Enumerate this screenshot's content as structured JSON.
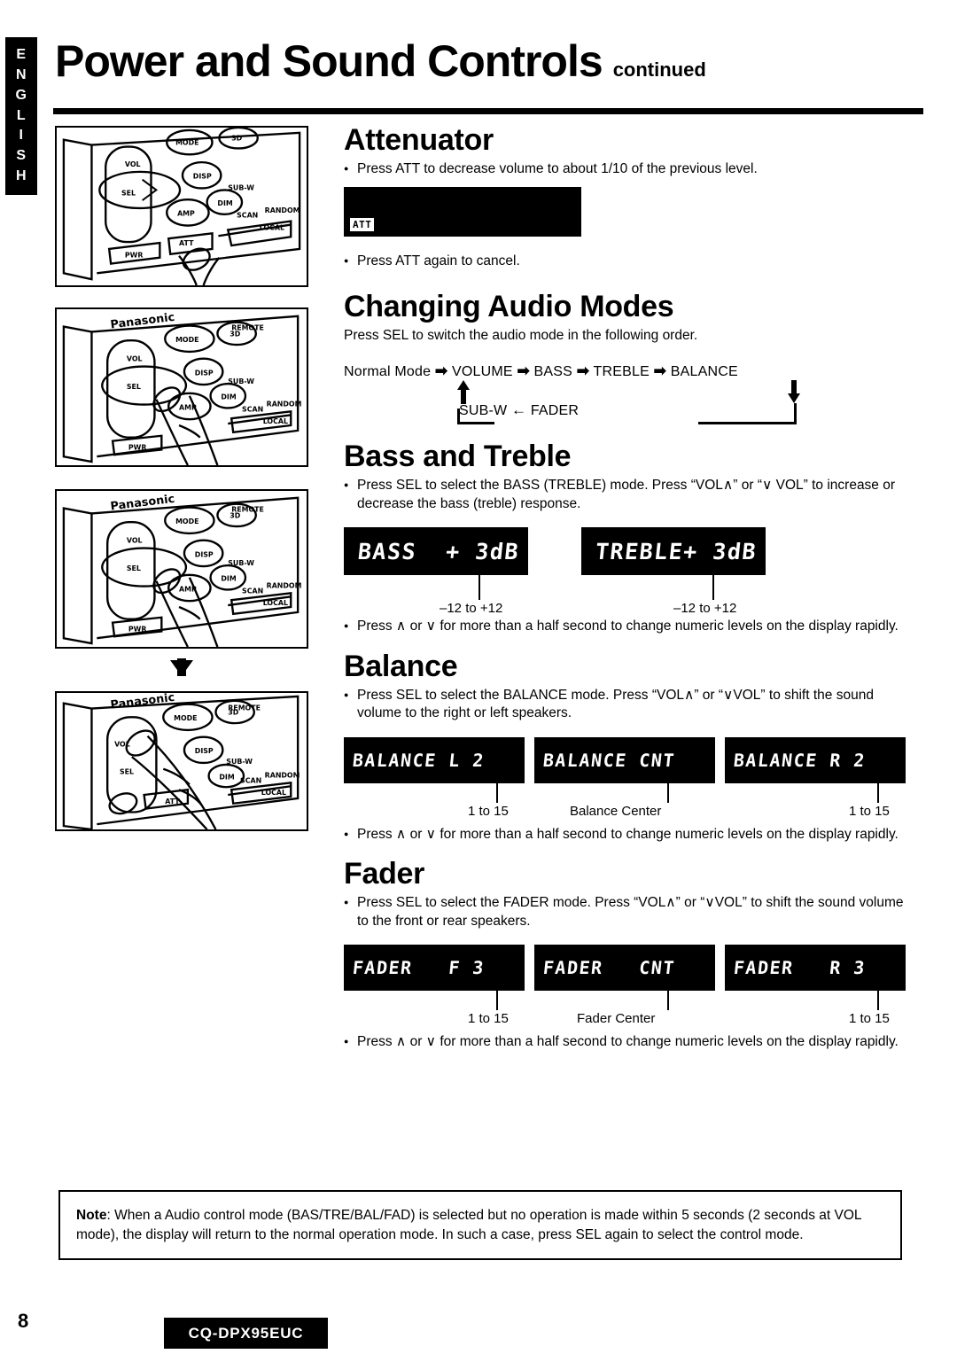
{
  "language_tab": "ENGLISH",
  "header": {
    "title": "Power and Sound Controls",
    "continued": "continued"
  },
  "illustrations": [
    {
      "name": "att-button-press",
      "caption": ""
    },
    {
      "name": "sel-button-press",
      "caption": ""
    },
    {
      "name": "sel-button-press-2",
      "caption": ""
    },
    {
      "name": "vol-up-button-press",
      "caption": ""
    }
  ],
  "sections": {
    "attenuator": {
      "title": "Attenuator",
      "bullet_1": "Press ATT to decrease volume to about 1/10 of the previous level.",
      "display": {
        "badge": "ATT"
      },
      "bullet_2": "Press ATT again to cancel."
    },
    "changing_audio_modes": {
      "title": "Changing Audio Modes",
      "intro": "Press SEL to switch the audio mode in the following order.",
      "flow_row_1": "Normal Mode",
      "flow_nodes_top": [
        "VOLUME",
        "BASS",
        "TREBLE",
        "BALANCE"
      ],
      "flow_nodes_bottom": [
        "SUB-W",
        "FADER"
      ],
      "arrow_right": "➡",
      "arrow_left": "←"
    },
    "bass_and_treble": {
      "title": "Bass and Treble",
      "bullet_1": "Press SEL to select the BASS (TREBLE) mode. Press “VOL∧” or “∨ VOL” to increase or decrease the bass (treble) response.",
      "displays": [
        {
          "text": "BASS  + 3dB",
          "callout": "‒12 to +12"
        },
        {
          "text": "TREBLE+ 3dB",
          "callout": "‒12 to +12"
        }
      ],
      "bullet_2": "Press ∧ or ∨ for more than a half second to change numeric levels on the display rapidly."
    },
    "balance": {
      "title": "Balance",
      "bullet_1": "Press SEL to select the BALANCE mode. Press “VOL∧” or “∨VOL” to shift the sound volume to the right or left speakers.",
      "displays": [
        {
          "text": "BALANCE L 2",
          "callout": "1 to 15"
        },
        {
          "text": "BALANCE CNT",
          "callout": "Balance Center"
        },
        {
          "text": "BALANCE R 2",
          "callout": "1 to 15"
        }
      ],
      "bullet_2": "Press ∧ or ∨ for more than a half second to change numeric levels on the display rapidly."
    },
    "fader": {
      "title": "Fader",
      "bullet_1": "Press SEL to select the FADER mode. Press “VOL∧” or “∨VOL” to shift the sound volume to the front or rear speakers.",
      "displays": [
        {
          "text": "FADER   F 3",
          "callout": "1 to 15"
        },
        {
          "text": "FADER   CNT",
          "callout": "Fader Center"
        },
        {
          "text": "FADER   R 3",
          "callout": "1 to 15"
        }
      ],
      "bullet_2": "Press ∧ or ∨ for more than a half second to change numeric levels on the display rapidly."
    }
  },
  "note": {
    "label": "Note",
    "text": ":  When a Audio control mode (BAS/TRE/BAL/FAD) is selected but no operation is made within 5 seconds (2 seconds at VOL mode), the display will return to the normal operation  mode. In such a case, press SEL again to select  the control mode."
  },
  "footer": {
    "page_number": "8",
    "model": "CQ-DPX95EUC"
  },
  "colors": {
    "ink": "#000000",
    "paper": "#ffffff",
    "lcd_background": "#000000",
    "lcd_text": "#ffffff"
  }
}
